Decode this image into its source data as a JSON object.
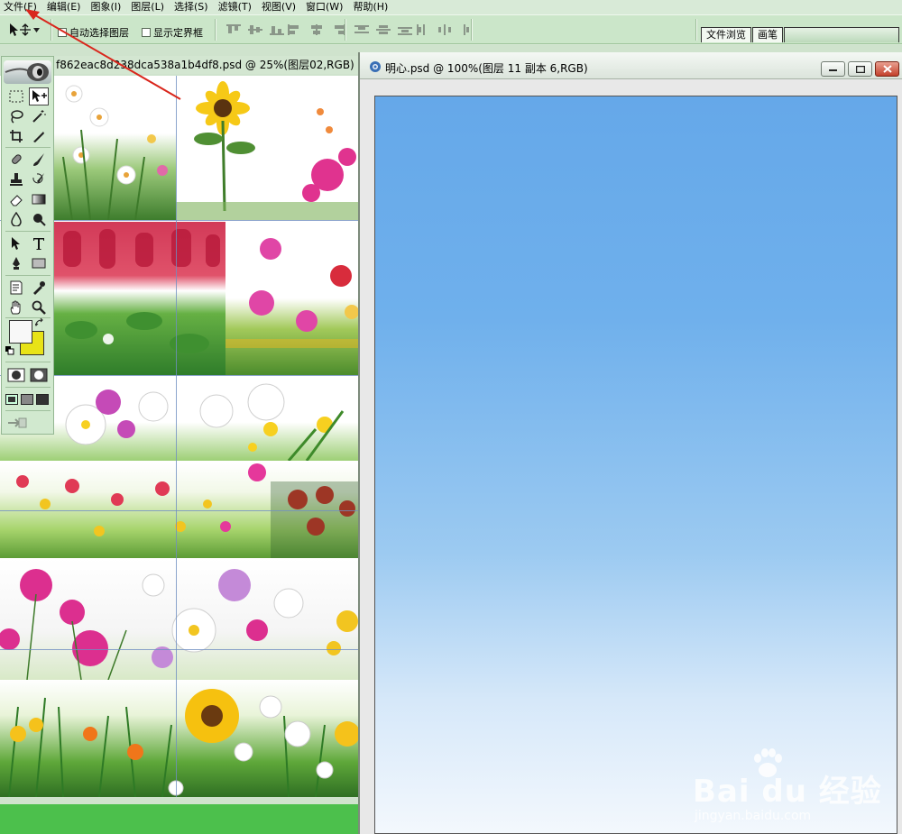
{
  "menu": [
    "文件(F)",
    "编辑(E)",
    "图象(I)",
    "图层(L)",
    "选择(S)",
    "滤镜(T)",
    "视图(V)",
    "窗口(W)",
    "帮助(H)"
  ],
  "options": {
    "auto_select_label": "自动选择图层",
    "show_bounds_label": "显示定界框"
  },
  "palette_well": {
    "tab_browser": "文件浏览",
    "tab_brushes": "画笔"
  },
  "doc1": {
    "title": "f862eac8d238dca538a1b4df8.psd @ 25%(图层02,RGB)"
  },
  "doc2": {
    "title": "明心.psd @ 100%(图层 11 副本 6,RGB)"
  },
  "watermark": {
    "brand": "Bai du 经验",
    "url": "jingyan.baidu.com"
  },
  "colors": {
    "foreground": "#f8f8f8",
    "background": "#e8e317",
    "workspace": "#cfe3cd",
    "status": "#4cc04c"
  }
}
